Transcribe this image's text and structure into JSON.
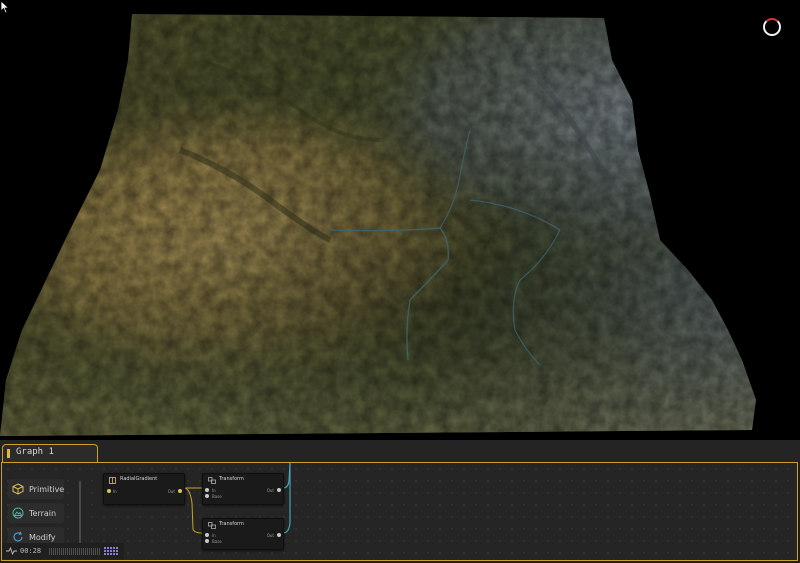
{
  "graph_tab": {
    "label": "Graph 1"
  },
  "palette": {
    "items": [
      {
        "label": "Primitive",
        "icon": "cube-icon"
      },
      {
        "label": "Terrain",
        "icon": "mountain-icon"
      },
      {
        "label": "Modify",
        "icon": "refresh-icon"
      }
    ]
  },
  "nodes": [
    {
      "title": "RadialGradient",
      "in_port": "In",
      "out_port": "Out"
    },
    {
      "title": "Transform",
      "in_port": "In",
      "second_port": "Base",
      "out_port": "Out"
    },
    {
      "title": "Transform",
      "in_port": "In",
      "second_port": "Base",
      "out_port": "Out"
    }
  ],
  "status": {
    "time": "00:28",
    "icon": "activity-icon"
  },
  "colors": {
    "accent": "#c9a227",
    "busy_ring": "#f2f2f2",
    "busy_arc": "#d23b2b",
    "wire_yellow": "#c9a227",
    "wire_teal": "#49a3b8"
  }
}
